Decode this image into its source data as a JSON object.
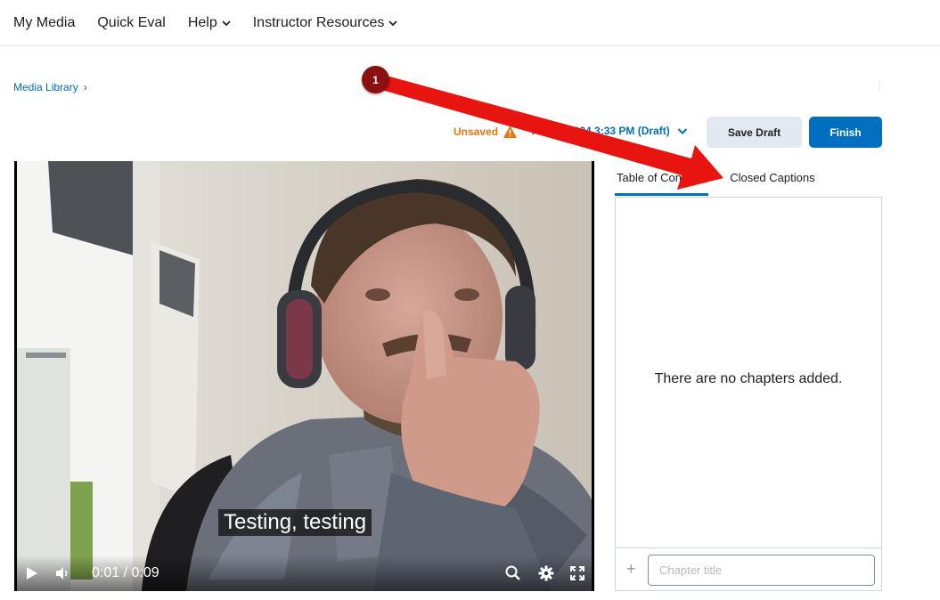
{
  "topnav": {
    "items": [
      {
        "label": "My Media",
        "dropdown": false
      },
      {
        "label": "Quick Eval",
        "dropdown": false
      },
      {
        "label": "Help",
        "dropdown": true
      },
      {
        "label": "Instructor Resources",
        "dropdown": true
      }
    ]
  },
  "breadcrumb": {
    "label": "Media Library",
    "separator": "›"
  },
  "toolbar": {
    "unsaved_label": "Unsaved",
    "revision_label": "Aug 4, 2024 3:33 PM (Draft)",
    "save_draft_label": "Save Draft",
    "finish_label": "Finish"
  },
  "video": {
    "caption": "Testing, testing",
    "current_time": "0:01",
    "duration": "0:09",
    "time_separator": "/"
  },
  "panel": {
    "tabs": [
      {
        "label": "Table of Contents",
        "active": true
      },
      {
        "label": "Closed Captions",
        "active": false
      }
    ],
    "empty_message": "There are no chapters added.",
    "add_symbol": "+",
    "chapter_placeholder": "Chapter title"
  },
  "annotation": {
    "step_number": "1",
    "color": "#e8140f",
    "badge_color": "#8b1111"
  },
  "colors": {
    "primary": "#006fbf",
    "warning": "#e87511",
    "secondary_button": "#e3e9f1"
  }
}
